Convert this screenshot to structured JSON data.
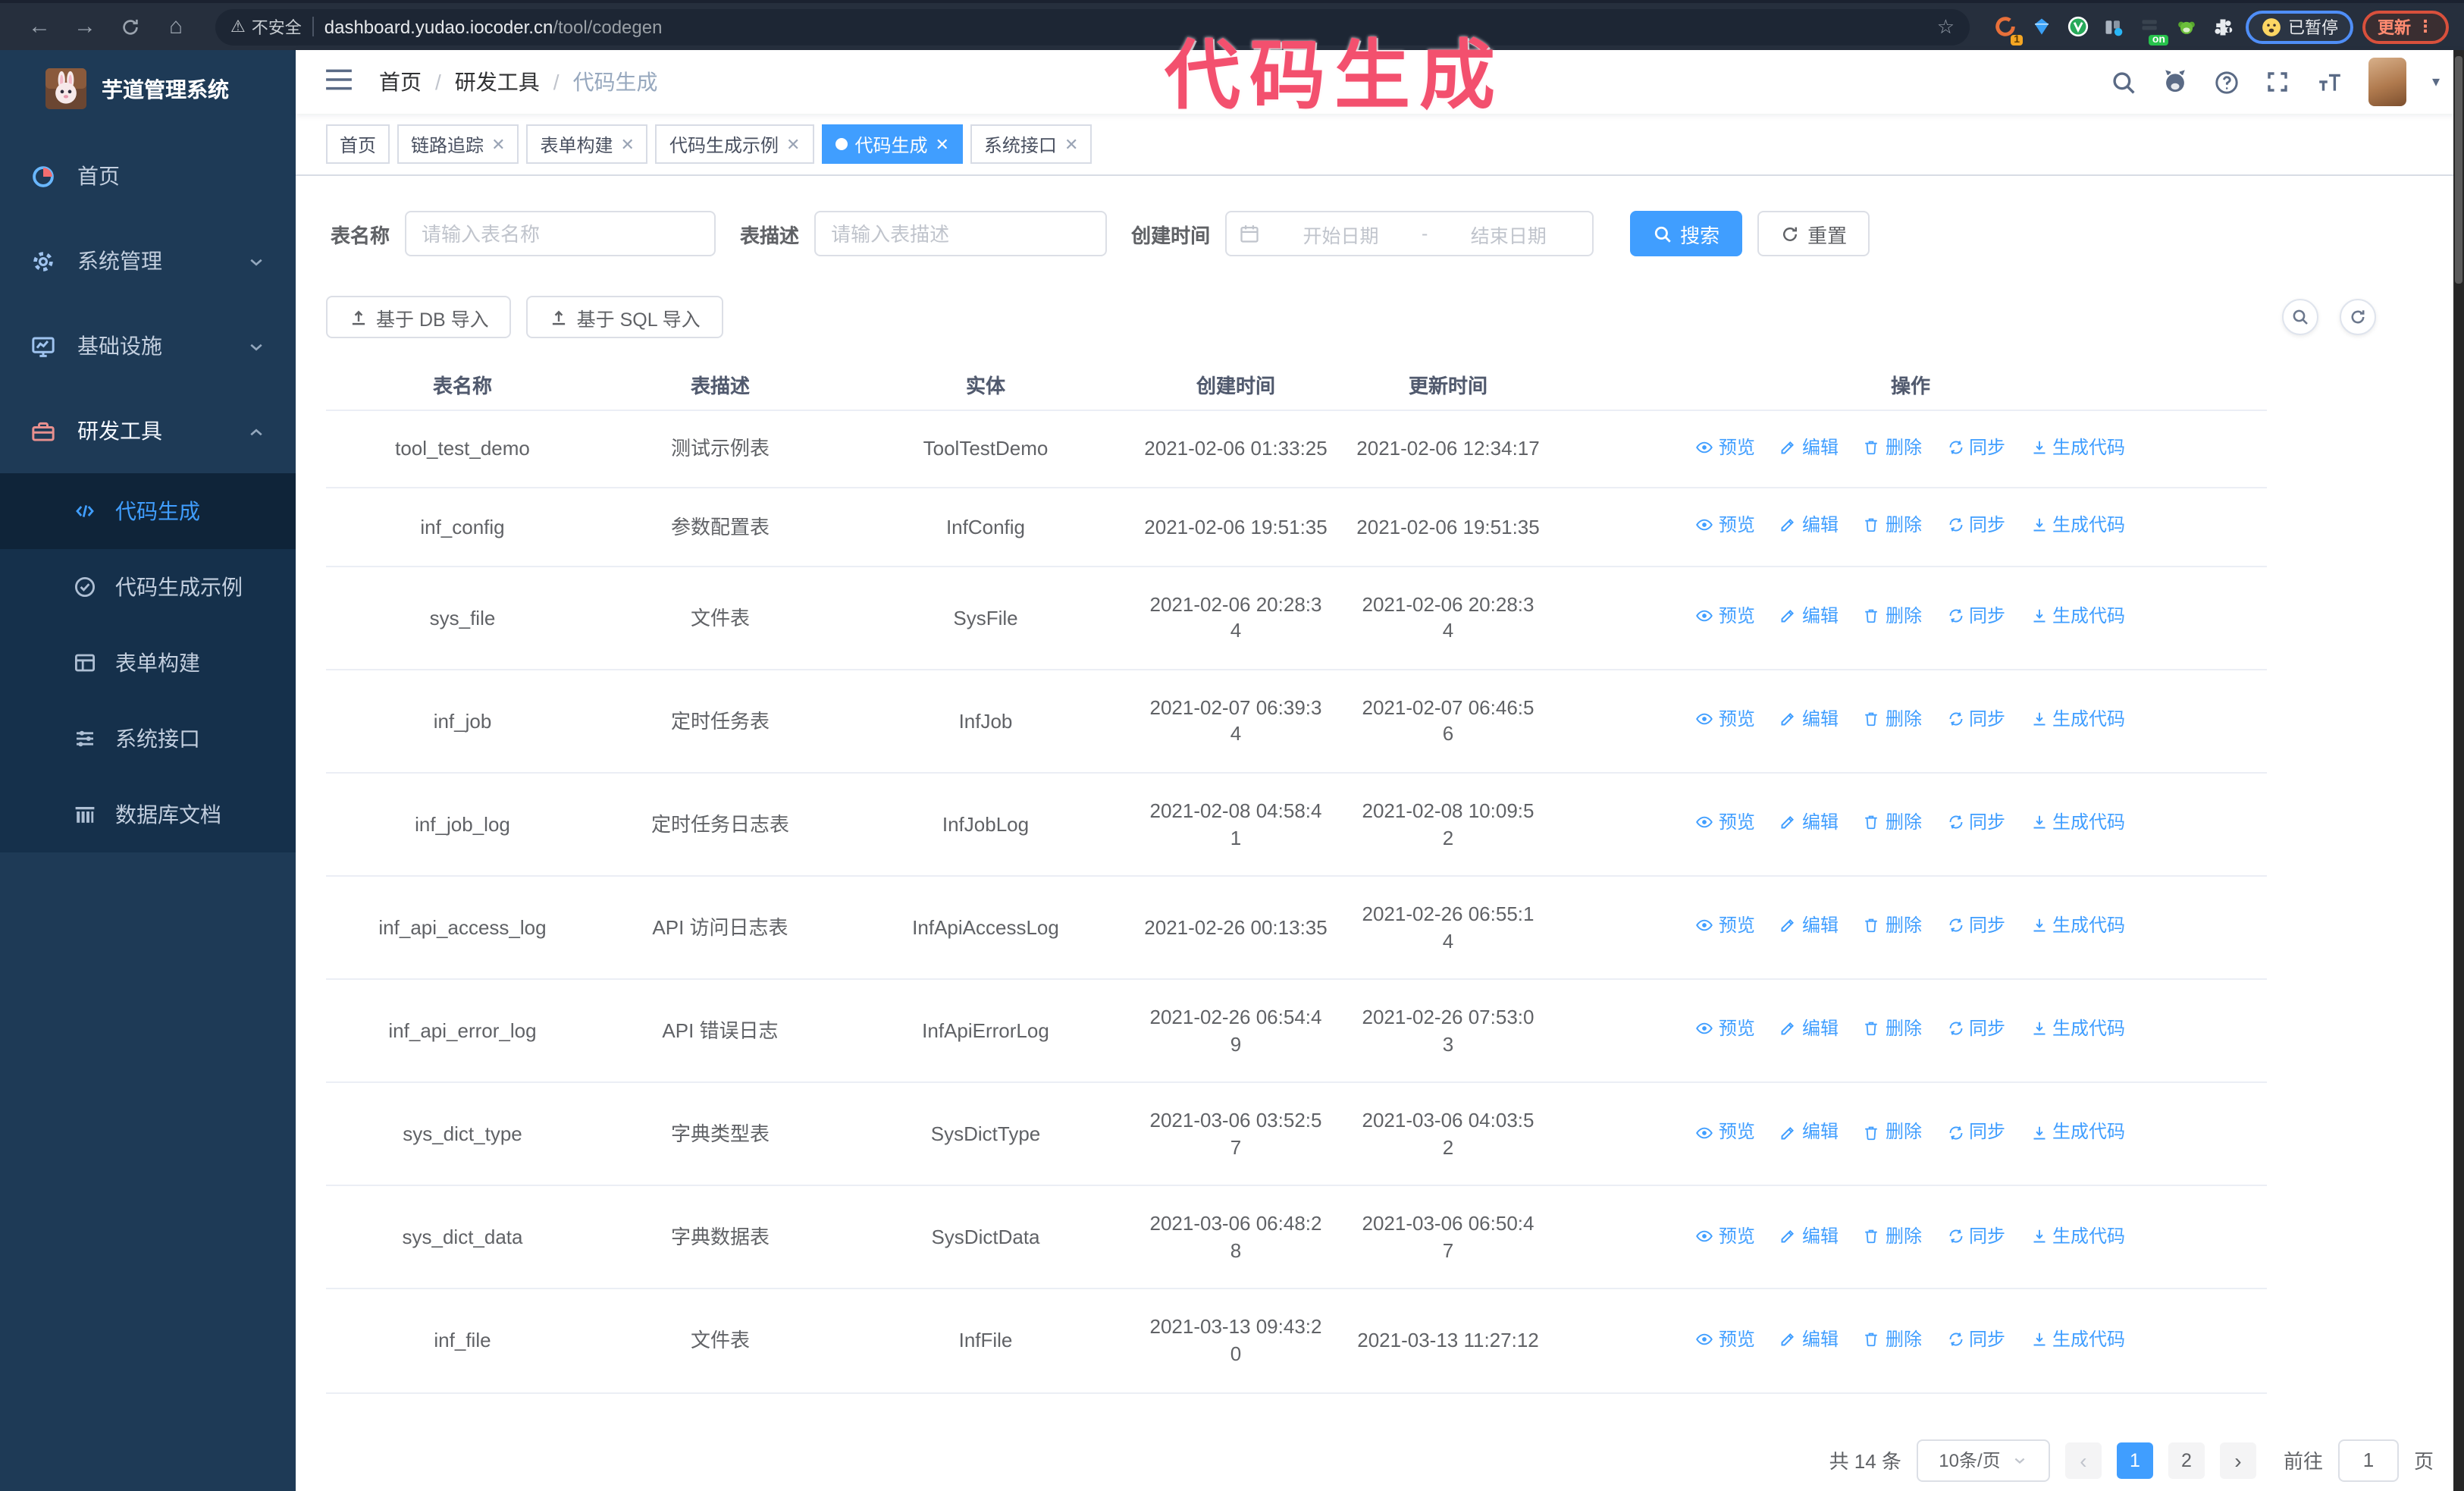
{
  "annotation": {
    "text": "代码生成"
  },
  "browser": {
    "nav_icons": [
      "back-icon",
      "forward-icon",
      "reload-icon",
      "home-icon"
    ],
    "insecure_label": "不安全",
    "url_host": "dashboard.yudao.iocoder.cn",
    "url_path": "/tool/codegen",
    "extension_badge": "1",
    "extension_on_badge": "on",
    "paused_badge": "已暂停",
    "update_button": "更新",
    "menu_dots": "⋮"
  },
  "sidebar": {
    "title": "芋道管理系统",
    "items": [
      {
        "label": "首页",
        "icon": "dashboard-icon",
        "chevron": null,
        "active": false
      },
      {
        "label": "系统管理",
        "icon": "gear-icon",
        "chevron": "down",
        "active": false
      },
      {
        "label": "基础设施",
        "icon": "monitor-icon",
        "chevron": "down",
        "active": false
      },
      {
        "label": "研发工具",
        "icon": "toolbox-icon",
        "chevron": "up",
        "active": true
      }
    ],
    "subitems": [
      {
        "label": "代码生成",
        "icon": "code-icon",
        "active": true
      },
      {
        "label": "代码生成示例",
        "icon": "check-circle-icon",
        "active": false
      },
      {
        "label": "表单构建",
        "icon": "form-icon",
        "active": false
      },
      {
        "label": "系统接口",
        "icon": "sliders-icon",
        "active": false
      },
      {
        "label": "数据库文档",
        "icon": "database-icon",
        "active": false
      }
    ]
  },
  "header": {
    "breadcrumb": [
      "首页",
      "研发工具",
      "代码生成"
    ],
    "separator": "/",
    "right_icons": [
      "search-icon",
      "github-icon",
      "help-icon",
      "fullscreen-icon",
      "font-size-icon"
    ]
  },
  "tabs": [
    {
      "label": "首页",
      "closable": false,
      "active": false
    },
    {
      "label": "链路追踪",
      "closable": true,
      "active": false
    },
    {
      "label": "表单构建",
      "closable": true,
      "active": false
    },
    {
      "label": "代码生成示例",
      "closable": true,
      "active": false
    },
    {
      "label": "代码生成",
      "closable": true,
      "active": true
    },
    {
      "label": "系统接口",
      "closable": true,
      "active": false
    }
  ],
  "filters": {
    "name_label": "表名称",
    "name_placeholder": "请输入表名称",
    "desc_label": "表描述",
    "desc_placeholder": "请输入表描述",
    "time_label": "创建时间",
    "start_placeholder": "开始日期",
    "range_separator": "-",
    "end_placeholder": "结束日期",
    "search_button": "搜索",
    "reset_button": "重置"
  },
  "toolbar": {
    "import_db": "基于 DB 导入",
    "import_sql": "基于 SQL 导入",
    "round_buttons": [
      "search-toggle-icon",
      "refresh-icon"
    ]
  },
  "table": {
    "columns": [
      "表名称",
      "表描述",
      "实体",
      "创建时间",
      "更新时间",
      "操作"
    ],
    "actions": [
      {
        "name": "preview-link",
        "label": "预览",
        "icon": "eye-icon"
      },
      {
        "name": "edit-link",
        "label": "编辑",
        "icon": "edit-icon"
      },
      {
        "name": "delete-link",
        "label": "删除",
        "icon": "delete-icon"
      },
      {
        "name": "sync-link",
        "label": "同步",
        "icon": "sync-icon"
      },
      {
        "name": "generate-code-link",
        "label": "生成代码",
        "icon": "download-icon"
      }
    ],
    "rows": [
      {
        "name": "tool_test_demo",
        "desc": "测试示例表",
        "entity": "ToolTestDemo",
        "created": [
          "2021-02-06 01:33:25"
        ],
        "updated": [
          "2021-02-06 12:34:17"
        ]
      },
      {
        "name": "inf_config",
        "desc": "参数配置表",
        "entity": "InfConfig",
        "created": [
          "2021-02-06 19:51:35"
        ],
        "updated": [
          "2021-02-06 19:51:35"
        ]
      },
      {
        "name": "sys_file",
        "desc": "文件表",
        "entity": "SysFile",
        "created": [
          "2021-02-06 20:28:3",
          "4"
        ],
        "updated": [
          "2021-02-06 20:28:3",
          "4"
        ]
      },
      {
        "name": "inf_job",
        "desc": "定时任务表",
        "entity": "InfJob",
        "created": [
          "2021-02-07 06:39:3",
          "4"
        ],
        "updated": [
          "2021-02-07 06:46:5",
          "6"
        ]
      },
      {
        "name": "inf_job_log",
        "desc": "定时任务日志表",
        "entity": "InfJobLog",
        "created": [
          "2021-02-08 04:58:4",
          "1"
        ],
        "updated": [
          "2021-02-08 10:09:5",
          "2"
        ]
      },
      {
        "name": "inf_api_access_log",
        "desc": "API 访问日志表",
        "entity": "InfApiAccessLog",
        "created": [
          "2021-02-26 00:13:35"
        ],
        "updated": [
          "2021-02-26 06:55:1",
          "4"
        ]
      },
      {
        "name": "inf_api_error_log",
        "desc": "API 错误日志",
        "entity": "InfApiErrorLog",
        "created": [
          "2021-02-26 06:54:4",
          "9"
        ],
        "updated": [
          "2021-02-26 07:53:0",
          "3"
        ]
      },
      {
        "name": "sys_dict_type",
        "desc": "字典类型表",
        "entity": "SysDictType",
        "created": [
          "2021-03-06 03:52:5",
          "7"
        ],
        "updated": [
          "2021-03-06 04:03:5",
          "2"
        ]
      },
      {
        "name": "sys_dict_data",
        "desc": "字典数据表",
        "entity": "SysDictData",
        "created": [
          "2021-03-06 06:48:2",
          "8"
        ],
        "updated": [
          "2021-03-06 06:50:4",
          "7"
        ]
      },
      {
        "name": "inf_file",
        "desc": "文件表",
        "entity": "InfFile",
        "created": [
          "2021-03-13 09:43:2",
          "0"
        ],
        "updated": [
          "2021-03-13 11:27:12"
        ]
      }
    ]
  },
  "pagination": {
    "total": "共 14 条",
    "page_size": "10条/页",
    "prev": "‹",
    "next": "›",
    "pages": [
      "1",
      "2"
    ],
    "active_page": "1",
    "goto_label": "前往",
    "goto_value": "1",
    "page_unit": "页"
  },
  "colors": {
    "primary": "#409eff",
    "sidebar_bg": "#1e3a56",
    "submenu_bg": "#15304b",
    "annotation": "#f3506e",
    "chrome_bg": "#262f3d"
  }
}
